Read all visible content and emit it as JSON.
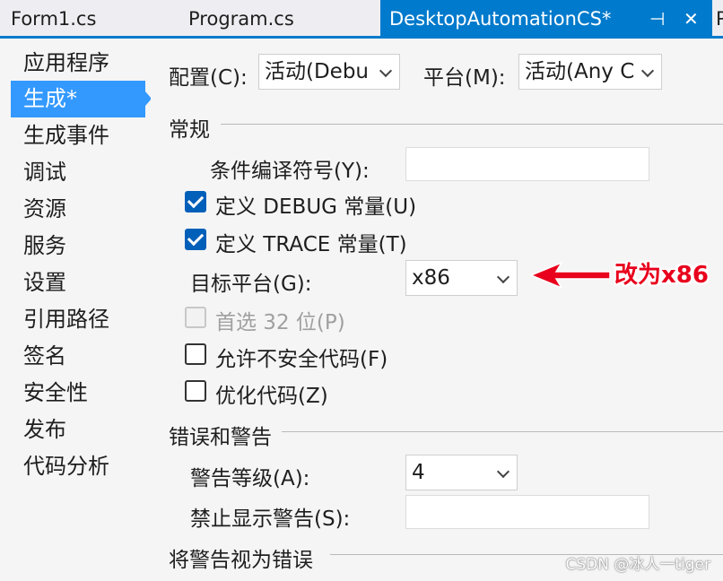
{
  "tabs": [
    {
      "label": "Form1.cs",
      "active": false
    },
    {
      "label": "Program.cs",
      "active": false
    },
    {
      "label": "DesktopAutomationCS*",
      "active": true
    },
    {
      "label": "P",
      "active": false
    }
  ],
  "tab_icons": {
    "pin": "pin-icon",
    "close": "close-icon",
    "pin_glyph": "⊣",
    "close_glyph": "✕"
  },
  "nav": {
    "items": [
      "应用程序",
      "生成*",
      "生成事件",
      "调试",
      "资源",
      "服务",
      "设置",
      "引用路径",
      "签名",
      "安全性",
      "发布",
      "代码分析"
    ],
    "selected_index": 1
  },
  "config": {
    "config_label": "配置(C):",
    "config_value": "活动(Debu",
    "platform_label": "平台(M):",
    "platform_value": "活动(Any C"
  },
  "general": {
    "header": "常规",
    "conditional_symbols_label": "条件编译符号(Y):",
    "conditional_symbols_value": "",
    "define_debug": {
      "label": "定义 DEBUG 常量(U)",
      "checked": true
    },
    "define_trace": {
      "label": "定义 TRACE 常量(T)",
      "checked": true
    },
    "target_platform_label": "目标平台(G):",
    "target_platform_value": "x86",
    "prefer32": {
      "label": "首选 32 位(P)",
      "checked": false,
      "enabled": false
    },
    "allow_unsafe": {
      "label": "允许不安全代码(F)",
      "checked": false
    },
    "optimize": {
      "label": "优化代码(Z)",
      "checked": false
    }
  },
  "errors_warnings": {
    "header": "错误和警告",
    "warning_level_label": "警告等级(A):",
    "warning_level_value": "4",
    "suppress_label": "禁止显示警告(S):",
    "suppress_value": ""
  },
  "treat_warnings": {
    "header": "将警告视为错误"
  },
  "annotation": {
    "text": "改为x86",
    "color": "#e8001c"
  },
  "watermark": "CSDN @冰人一tiger",
  "colors": {
    "accent": "#007acc",
    "nav_selected": "#3399ff",
    "checkbox": "#005fb8"
  }
}
